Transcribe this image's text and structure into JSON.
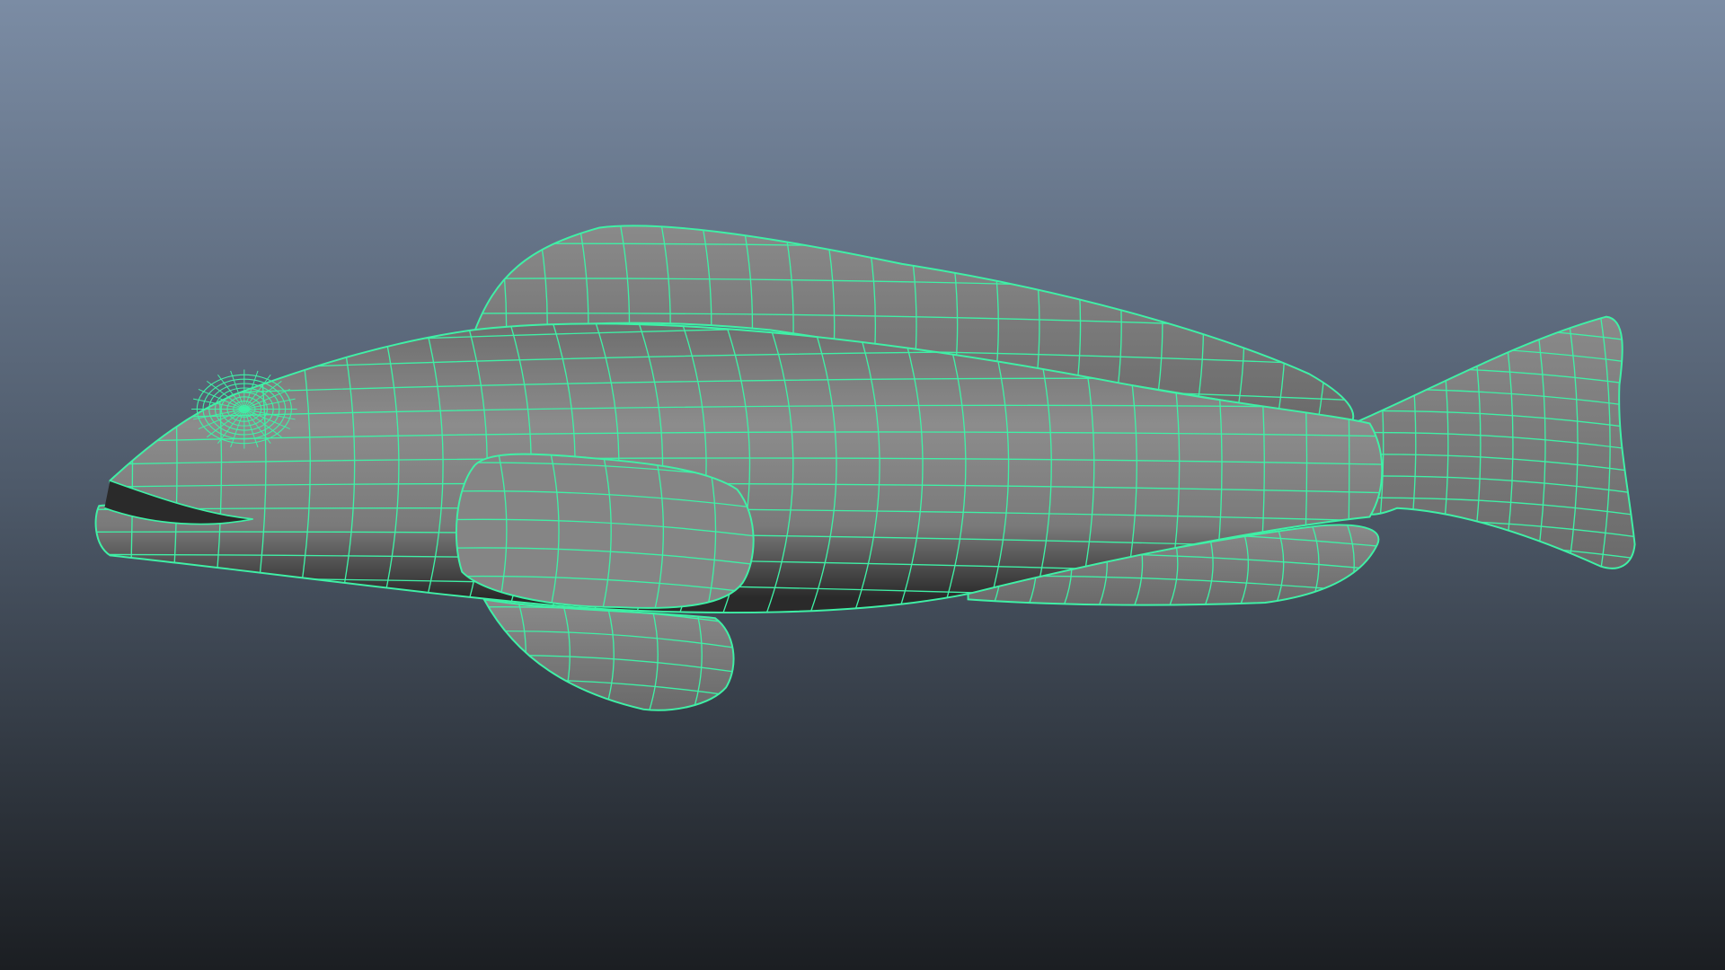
{
  "viewport": {
    "object": "fish-mesh",
    "display_mode": "smooth-shaded-with-wireframe",
    "colors": {
      "background_top": "#7b8ca4",
      "background_middle": "#4e5a6a",
      "background_bottom": "#1b1e22",
      "wireframe": "#3ff0a6",
      "surface_light": "#8a8a8a",
      "surface_dark": "#3a3a3a"
    }
  }
}
